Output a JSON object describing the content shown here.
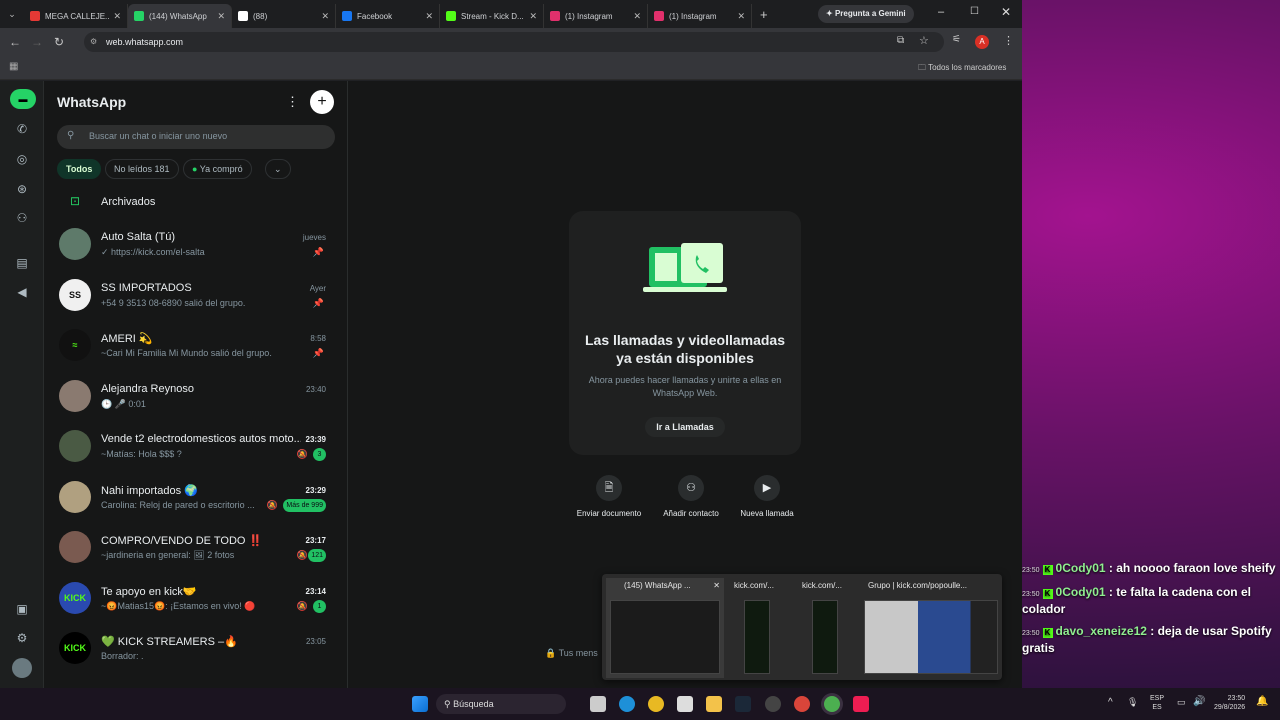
{
  "browser": {
    "tabs": [
      {
        "title": "MEGA CALLEJE...",
        "color": "#e53935"
      },
      {
        "title": "(144) WhatsApp",
        "color": "#25d366"
      },
      {
        "title": "(88)",
        "color": "#ffffff"
      },
      {
        "title": "Facebook",
        "color": "#1877f2"
      },
      {
        "title": "Stream - Kick D...",
        "color": "#53fc18"
      },
      {
        "title": "(1) Instagram",
        "color": "#e1306c"
      },
      {
        "title": "(1) Instagram",
        "color": "#e1306c"
      }
    ],
    "gemini_label": "Pregunta a Gemini",
    "url": "web.whatsapp.com",
    "bookmarks_label": "Todos los marcadores",
    "profile_letter": "A"
  },
  "whatsapp": {
    "title": "WhatsApp",
    "search_placeholder": "Buscar un chat o iniciar uno nuevo",
    "filters": [
      {
        "label": "Todos"
      },
      {
        "label": "No leídos 181"
      },
      {
        "label": "Ya compró"
      }
    ],
    "archived_label": "Archivados",
    "chats": [
      {
        "name": "Auto Salta (Tú)",
        "preview": "✓ https://kick.com/el-salta",
        "time": "jueves",
        "avatar_color": "#5e7a6a",
        "avatar_text": ""
      },
      {
        "name": "SS IMPORTADOS",
        "preview": "+54 9 3513 08-6890 salió del grupo.",
        "time": "Ayer",
        "avatar_color": "#f0f0f0",
        "avatar_text": "SS"
      },
      {
        "name": "AMERI 💫",
        "preview": "~Cari Mi Familia Mi Mundo salió del grupo.",
        "time": "8:58",
        "avatar_color": "#111111",
        "avatar_text": "≈"
      },
      {
        "name": "Alejandra Reynoso",
        "preview": "🕒 🎤 0:01",
        "time": "23:40",
        "avatar_color": "#8a7a70",
        "avatar_text": ""
      },
      {
        "name": "Vende t2 electrodomesticos autos moto...",
        "preview": "~Matías: Hola $$$ ?",
        "time": "23:39",
        "badge": "3",
        "avatar_color": "#4a5a44",
        "avatar_text": ""
      },
      {
        "name": "Nahi importados 🌍",
        "preview": "Carolina: Reloj de pared o escritorio ...",
        "time": "23:29",
        "badge": "Más de 999",
        "avatar_color": "#b0a080",
        "avatar_text": ""
      },
      {
        "name": "COMPRO/VENDO DE TODO ‼️",
        "preview": "~jardineria en general: 🖼 2 fotos",
        "time": "23:17",
        "badge": "121",
        "avatar_color": "#7a5a50",
        "avatar_text": ""
      },
      {
        "name": "Te apoyo en kick🤝",
        "preview": "~😡Matias15😡: ¡Estamos en vivo! 🔴",
        "time": "23:14",
        "badge": "1",
        "avatar_color": "#2a4ab0",
        "avatar_text": "KICK"
      },
      {
        "name": "💚 KICK STREAMERS –🔥",
        "preview": "Borrador: .",
        "time": "23:05",
        "avatar_color": "#000000",
        "avatar_text": "KICK"
      }
    ],
    "callcard": {
      "title": "Las llamadas y videollamadas ya están disponibles",
      "subtitle": "Ahora puedes hacer llamadas y unirte a ellas en WhatsApp Web.",
      "button": "Ir a Llamadas"
    },
    "actions": [
      {
        "label": "Enviar documento",
        "icon": "document-icon"
      },
      {
        "label": "Añadir contacto",
        "icon": "add-contact-icon"
      },
      {
        "label": "Nueva llamada",
        "icon": "video-call-icon"
      }
    ],
    "encrypted_label": "Tus mens"
  },
  "taskbar_preview": {
    "windows": [
      {
        "title": "(145) WhatsApp ..."
      },
      {
        "title": "kick.com/..."
      },
      {
        "title": "kick.com/..."
      },
      {
        "title": "Grupo | kick.com/popoulle..."
      }
    ]
  },
  "stream_chat": [
    {
      "time": "23:50",
      "user": "0Cody01",
      "message": ": ah noooo faraon love sheify"
    },
    {
      "time": "23:50",
      "user": "0Cody01",
      "message": ": te falta la cadena con el colador"
    },
    {
      "time": "23:50",
      "user": "davo_xeneize12",
      "message": ": deja de usar Spotify gratis"
    }
  ],
  "taskbar": {
    "search_label": "Búsqueda",
    "lang": "ESP",
    "lang2": "ES",
    "clock_time": "23:50",
    "clock_date": "29/8/2026"
  }
}
